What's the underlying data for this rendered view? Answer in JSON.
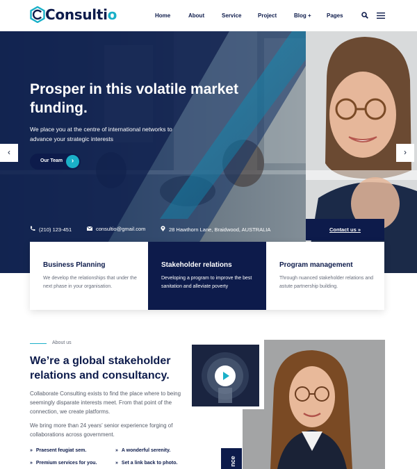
{
  "brand": {
    "name_main": "Consulti",
    "name_accent": "o",
    "accent_color": "#1ab0c8",
    "navy_color": "#0d1b4b"
  },
  "nav": {
    "items": [
      "Home",
      "About",
      "Service",
      "Project",
      "Blog +",
      "Pages"
    ]
  },
  "hero": {
    "title": "Prosper in this volatile market funding.",
    "subtitle": "We place you at the centre of international networks to advance your strategic interests",
    "cta_label": "Our Team",
    "cta_arrow": "›",
    "prev_arrow": "‹",
    "next_arrow": "›"
  },
  "contact": {
    "phone": "(210) 123-451",
    "email": "consultio@gmail.com",
    "address": "28 Hawthorn Lane, Braidwood, AUSTRALIA",
    "cta_label": "Contact us »"
  },
  "features": [
    {
      "title": "Business Planning",
      "text": "We develop the relationships that under the next phase in your organisation."
    },
    {
      "title": "Stakeholder relations",
      "text": "Developing a program to improve the best sanitation and alleviate poverty"
    },
    {
      "title": "Program management",
      "text": "Through nuanced stakeholder relations and astute partnership building."
    }
  ],
  "about": {
    "eyebrow": "About us",
    "title": "We’re a global stakeholder relations and consultancy.",
    "para1": "Collaborate Consulting exists to find the place where to being seemingly disparate interests meet. From that point of the connection, we create platforms.",
    "para2": "We bring more than 24 years’ senior experience forging of collaborations across government.",
    "bullets": [
      "Praesent feugiat sem.",
      "A wonderful serenity.",
      "Premium services for you.",
      "Set a link back to photo."
    ],
    "bullet_marker": "»",
    "tag_text": "nce"
  }
}
